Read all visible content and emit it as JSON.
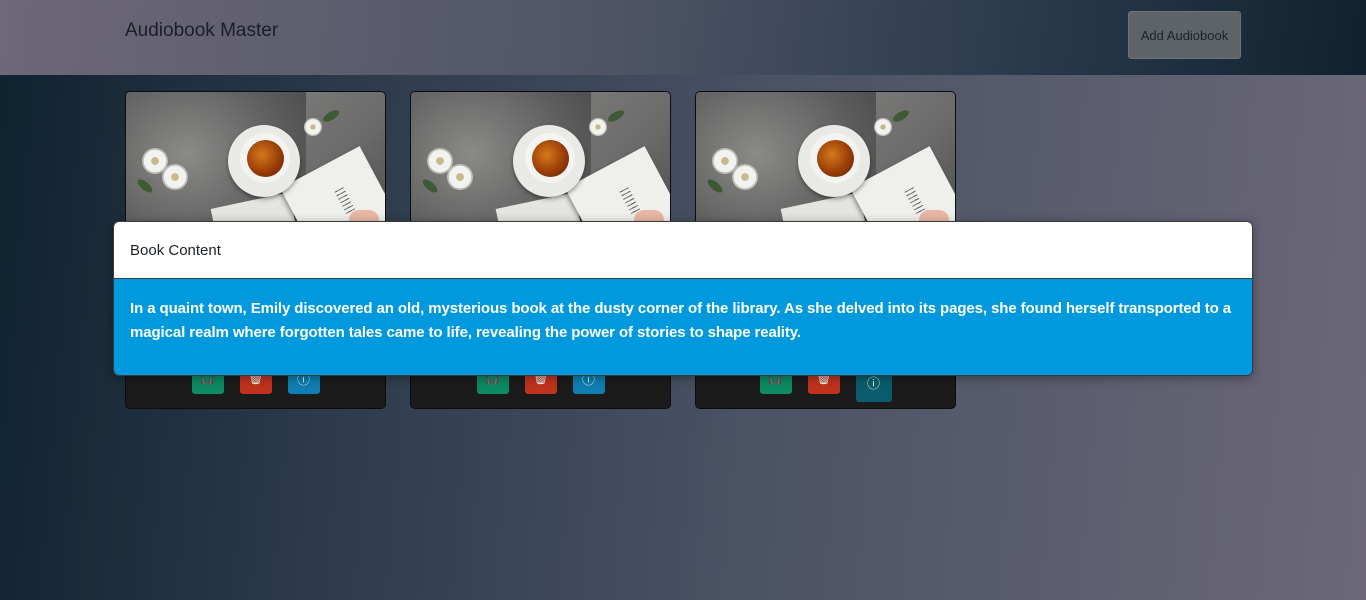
{
  "header": {
    "brand": "Audiobook Master",
    "add_button_label": "Add Audiobook"
  },
  "cards": [
    {
      "actions": [
        {
          "icon": "headphones-icon"
        },
        {
          "icon": "trash-icon"
        },
        {
          "icon": "info-icon"
        }
      ]
    },
    {
      "actions": [
        {
          "icon": "headphones-icon"
        },
        {
          "icon": "trash-icon"
        },
        {
          "icon": "info-icon"
        }
      ]
    },
    {
      "actions": [
        {
          "icon": "headphones-icon"
        },
        {
          "icon": "trash-icon"
        },
        {
          "icon": "info-icon"
        }
      ]
    }
  ],
  "modal": {
    "title": "Book Content",
    "body": "In a quaint town, Emily discovered an old, mysterious book at the dusty corner of the library. As she delved into its pages, she found herself transported to a magical realm where forgotten tales came to life, revealing the power of stories to shape reality."
  },
  "colors": {
    "modal_body": "#0099de",
    "listen": "#0c8a62",
    "delete": "#c1321f",
    "info": "#0e7fb0"
  }
}
